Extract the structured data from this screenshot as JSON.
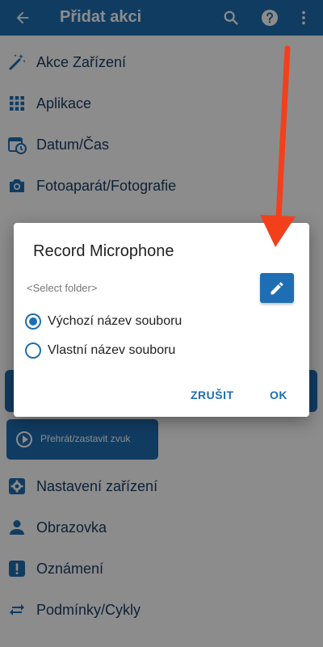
{
  "appbar": {
    "title": "Přidat akci",
    "icons": [
      "back-arrow-icon",
      "search-icon",
      "help-icon",
      "more-vert-icon"
    ]
  },
  "list": {
    "items": [
      {
        "label": "Akce Zařízení",
        "icon": "magic-wand-icon"
      },
      {
        "label": "Aplikace",
        "icon": "apps-grid-icon"
      },
      {
        "label": "Datum/Čas",
        "icon": "calendar-clock-icon"
      },
      {
        "label": "Fotoaparát/Fotografie",
        "icon": "camera-icon"
      },
      {
        "label": "Nastavení zařízení",
        "icon": "settings-box-icon"
      },
      {
        "label": "Obrazovka",
        "icon": "person-icon"
      },
      {
        "label": "Oznámení",
        "icon": "alert-box-icon"
      },
      {
        "label": "Podmínky/Cykly",
        "icon": "repeat-icon"
      }
    ],
    "sub_button_label": "Přehrát/zastavit zvuk"
  },
  "dialog": {
    "title": "Record Microphone",
    "folder_placeholder": "<Select folder>",
    "options": [
      {
        "label": "Výchozí název souboru",
        "selected": true
      },
      {
        "label": "Vlastní název souboru",
        "selected": false
      }
    ],
    "cancel_label": "ZRUŠIT",
    "ok_label": "OK"
  },
  "colors": {
    "primary": "#1f6eb3",
    "text_dark": "#1b3d63",
    "annotation_arrow": "#f2401c"
  }
}
